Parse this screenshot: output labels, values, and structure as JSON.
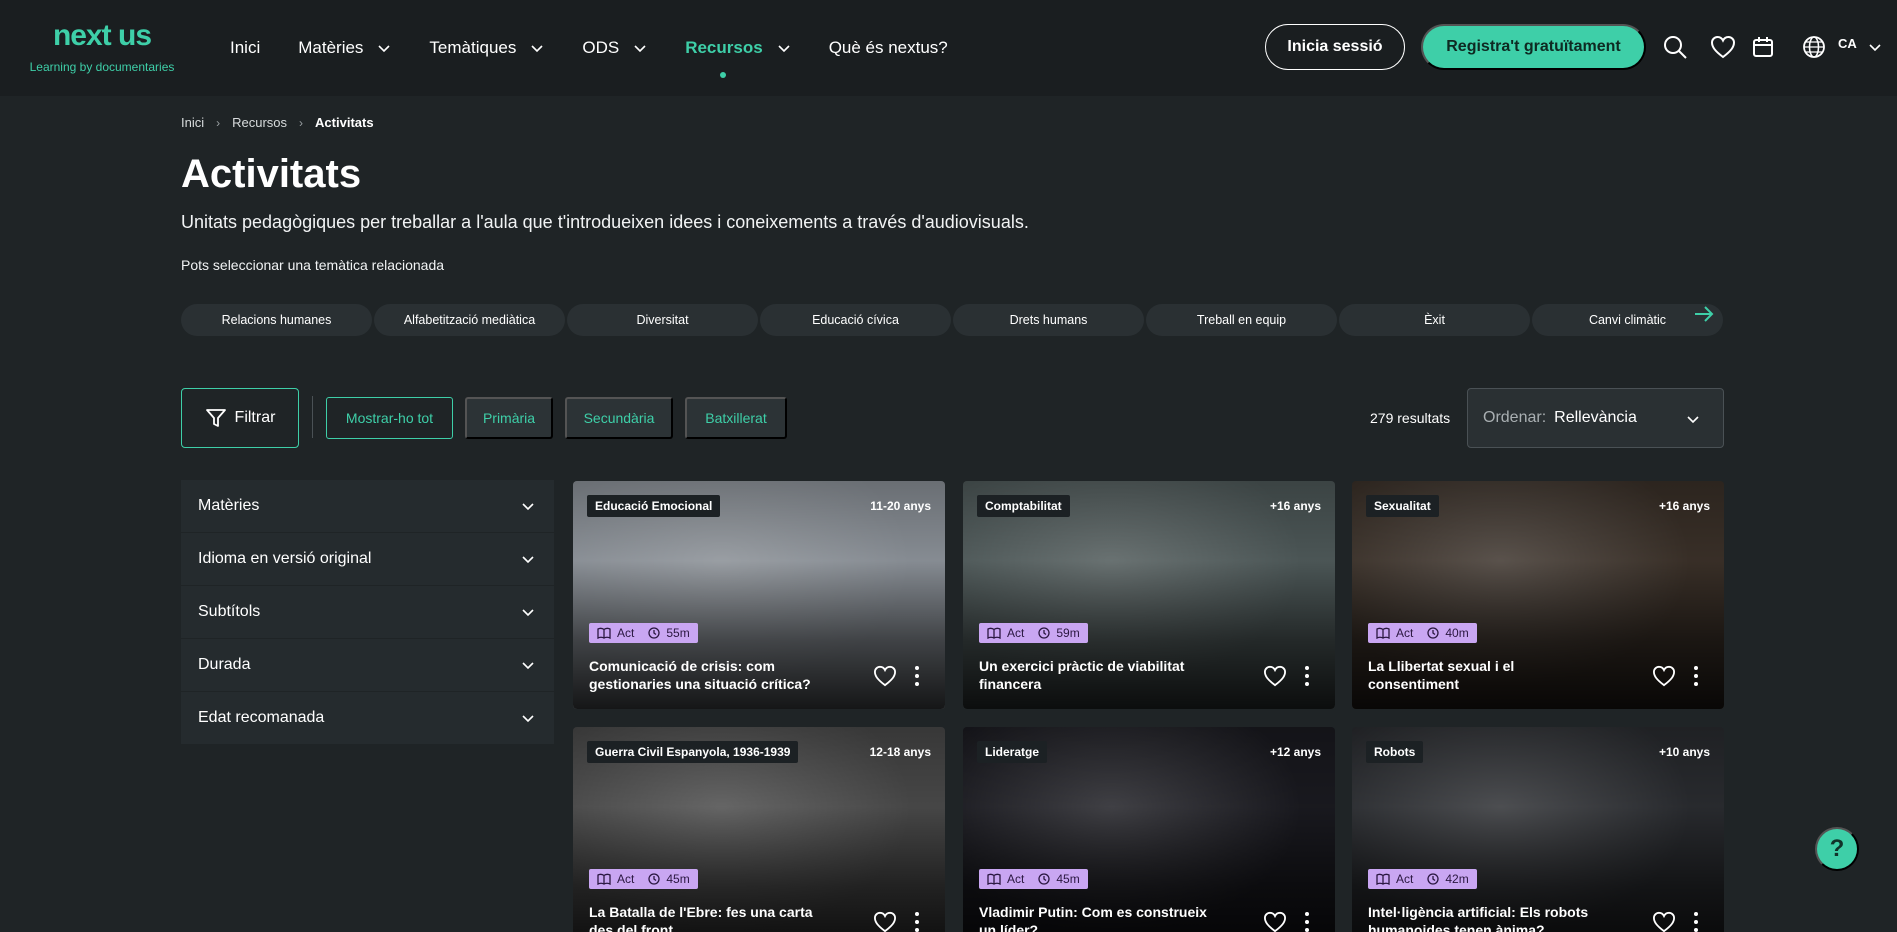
{
  "brand": {
    "name": "next us",
    "tagline": "Learning by documentaries",
    "accent": "#3ecfa8"
  },
  "nav": {
    "items": [
      {
        "label": "Inici",
        "dropdown": false,
        "active": false
      },
      {
        "label": "Matèries",
        "dropdown": true,
        "active": false
      },
      {
        "label": "Temàtiques",
        "dropdown": true,
        "active": false
      },
      {
        "label": "ODS",
        "dropdown": true,
        "active": false
      },
      {
        "label": "Recursos",
        "dropdown": true,
        "active": true
      },
      {
        "label": "Què és nextus?",
        "dropdown": false,
        "active": false
      }
    ],
    "login_label": "Inicia sessió",
    "register_label": "Registra't gratuïtament",
    "language": "CA",
    "icons": [
      "search-icon",
      "heart-icon",
      "calendar-icon",
      "globe-icon"
    ]
  },
  "breadcrumb": [
    "Inici",
    "Recursos",
    "Activitats"
  ],
  "page": {
    "title": "Activitats",
    "subtitle": "Unitats pedagògiques per treballar a l'aula que t'introdueixen idees i coneixements a través d'audiovisuals.",
    "theme_label": "Pots seleccionar una temàtica relacionada"
  },
  "themes": [
    "Relacions humanes",
    "Alfabetització mediàtica",
    "Diversitat",
    "Educació cívica",
    "Drets humans",
    "Treball en equip",
    "Èxit",
    "Canvi climàtic"
  ],
  "filters": {
    "filter_label": "Filtrar",
    "levels": [
      {
        "label": "Mostrar-ho tot",
        "selected": true
      },
      {
        "label": "Primària",
        "selected": false
      },
      {
        "label": "Secundària",
        "selected": false
      },
      {
        "label": "Batxillerat",
        "selected": false
      }
    ],
    "results": "279 resultats",
    "sort_label": "Ordenar:",
    "sort_value": "Rellevància"
  },
  "facets": [
    "Matèries",
    "Idioma en versió original",
    "Subtítols",
    "Durada",
    "Edat recomanada"
  ],
  "cards": [
    {
      "category": "Educació Emocional",
      "age": "11-20 anys",
      "type": "Act",
      "duration": "55m",
      "title": "Comunicació de crisis: com gestionaries una situació crítica?",
      "bg": "#8d939a"
    },
    {
      "category": "Comptabilitat",
      "age": "+16 anys",
      "type": "Act",
      "duration": "59m",
      "title": "Un exercici pràctic de viabilitat financera",
      "bg": "#4f5a5a"
    },
    {
      "category": "Sexualitat",
      "age": "+16 anys",
      "type": "Act",
      "duration": "40m",
      "title": "La Llibertat sexual i el consentiment",
      "bg": "#3b3129"
    },
    {
      "category": "Guerra Civil Espanyola, 1936-1939",
      "age": "12-18 anys",
      "type": "Act",
      "duration": "45m",
      "title": "La Batalla de l'Ebre: fes una carta des del front",
      "bg": "#4a4a4a"
    },
    {
      "category": "Lideratge",
      "age": "+12 anys",
      "type": "Act",
      "duration": "45m",
      "title": "Vladimir Putin: Com es construeix un líder?",
      "bg": "#1a1a20"
    },
    {
      "category": "Robots",
      "age": "+10 anys",
      "type": "Act",
      "duration": "42m",
      "title": "Intel·ligència artificial: Els robots humanoides tenen ànima?",
      "bg": "#2a2c30"
    }
  ],
  "help_label": "?"
}
